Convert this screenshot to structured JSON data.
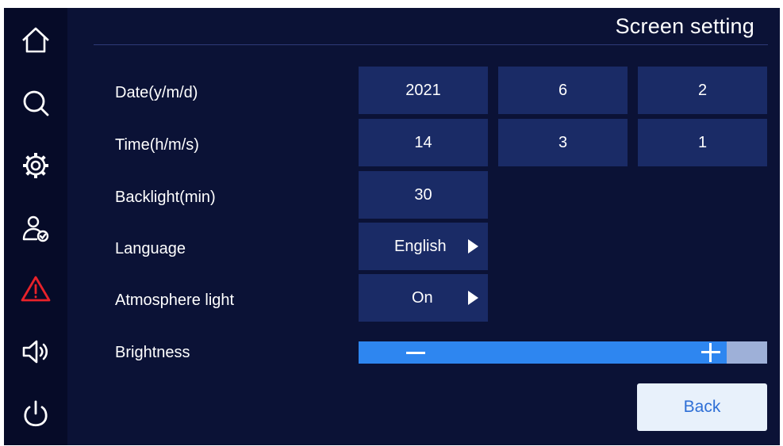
{
  "title": "Screen setting",
  "sidebar": {
    "icons": [
      "home-icon",
      "search-icon",
      "gear-icon",
      "user-check-icon",
      "warning-icon",
      "speaker-icon",
      "power-icon"
    ],
    "warning_color": "#e8222a"
  },
  "settings": {
    "date": {
      "label": "Date(y/m/d)",
      "year": "2021",
      "month": "6",
      "day": "2"
    },
    "time": {
      "label": "Time(h/m/s)",
      "hour": "14",
      "minute": "3",
      "second": "1"
    },
    "backlight": {
      "label": "Backlight(min)",
      "value": "30"
    },
    "language": {
      "label": "Language",
      "value": "English"
    },
    "atmosphere_light": {
      "label": "Atmosphere light",
      "value": "On"
    },
    "brightness": {
      "label": "Brightness",
      "level_fraction": 0.9
    }
  },
  "back_label": "Back",
  "colors": {
    "background": "#0b1236",
    "sidebar": "#060b28",
    "cell": "#1a2b66",
    "slider_fill": "#2e86f0",
    "slider_track": "#9eb0d8",
    "back_button": "#e8f1fb",
    "back_text": "#2e6fd6"
  }
}
